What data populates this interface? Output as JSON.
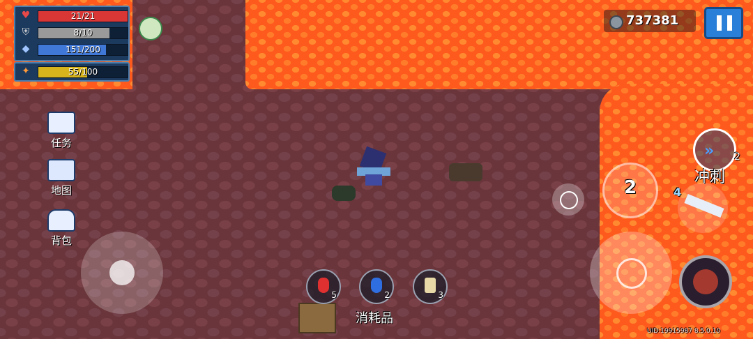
{
  "hud": {
    "health": {
      "text": "21/21",
      "fraction": 1.0,
      "color": "#d93636"
    },
    "armor": {
      "text": "8/10",
      "fraction": 0.8,
      "color": "#9a9a9a"
    },
    "energy": {
      "text": "151/200",
      "fraction": 0.755,
      "color": "#3f78d6"
    },
    "skill": {
      "text": "55/100",
      "fraction": 0.55,
      "color": "#d8b41c"
    }
  },
  "currency": {
    "icon": "coin-icon",
    "value": "737381"
  },
  "pause_icon": "pause-icon",
  "side_menu": [
    {
      "key": "tasks",
      "label": "任务",
      "icon": "task-list-icon"
    },
    {
      "key": "map",
      "label": "地图",
      "icon": "map-icon"
    },
    {
      "key": "backpack",
      "label": "背包",
      "icon": "backpack-icon"
    }
  ],
  "consumables": {
    "label": "消耗品",
    "slots": [
      {
        "item": "red-potion-icon",
        "count": "5",
        "color": "#e03030"
      },
      {
        "item": "blue-potion-icon",
        "count": "2",
        "color": "#2f6ee0"
      },
      {
        "item": "scroll-icon",
        "count": "3",
        "color": "#e8d8a8"
      }
    ]
  },
  "actions": {
    "dash_label": "冲刺",
    "dash_charges": "2",
    "weapon_swap_number": "2",
    "weapon_energy_cost": "4",
    "emote_icon": "smiley-icon",
    "attack_icon": "crosshair-icon",
    "skill_icon": "character-skill-icon"
  },
  "version": "UID:19915987 8.5.0.10",
  "colors": {
    "lava": "#ff5a1e",
    "floor": "#6a363c",
    "hud_bg": "#1b3a5e"
  }
}
